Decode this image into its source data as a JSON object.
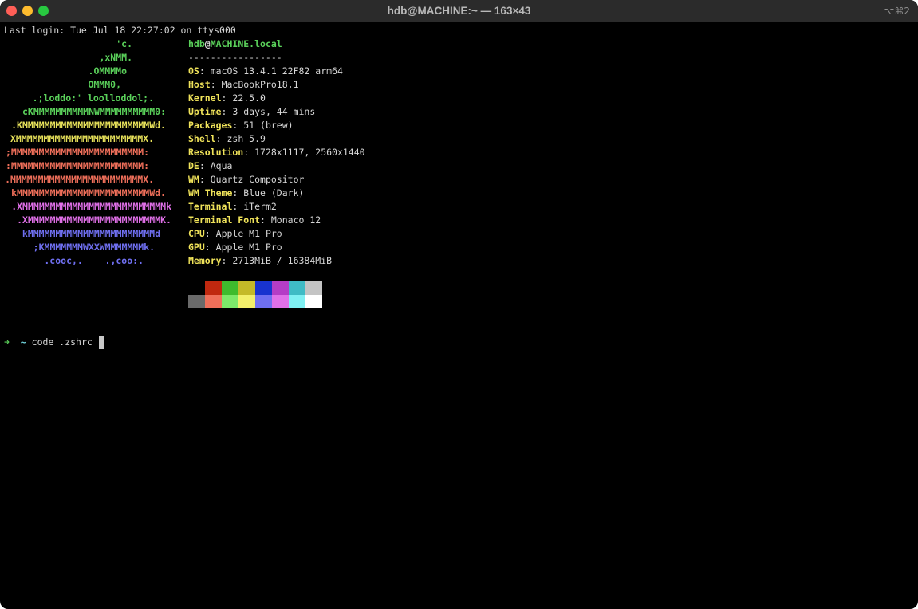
{
  "window": {
    "title": "hdb@MACHINE:~ — 163×43",
    "shortcut": "⌥⌘2",
    "traffic_lights": {
      "close_color": "#ff5f57",
      "minimize_color": "#febc2e",
      "zoom_color": "#28c840"
    }
  },
  "terminal": {
    "last_login": "Last login: Tue Jul 18 22:27:02 on ttys000",
    "logo_lines": [
      {
        "text": "'c.",
        "color": "#5ad05a"
      },
      {
        "text": ",xNMM.",
        "color": "#5ad05a"
      },
      {
        "text": ".OMMMMo",
        "color": "#5ad05a"
      },
      {
        "text": "OMMM0,",
        "color": "#5ad05a"
      },
      {
        "text": ".;loddo:' loolloddol;.",
        "color": "#5ad05a"
      },
      {
        "text": "cKMMMMMMMMMMNWMMMMMMMMMM0:",
        "color": "#5ad05a"
      },
      {
        "text": ".KMMMMMMMMMMMMMMMMMMMMMMMWd.",
        "color": "#e6e05a"
      },
      {
        "text": "XMMMMMMMMMMMMMMMMMMMMMMMX.",
        "color": "#e6e05a"
      },
      {
        "text": ";MMMMMMMMMMMMMMMMMMMMMMMM:",
        "color": "#ef6f5a"
      },
      {
        "text": ":MMMMMMMMMMMMMMMMMMMMMMMM:",
        "color": "#ef6f5a"
      },
      {
        "text": ".MMMMMMMMMMMMMMMMMMMMMMMMX.",
        "color": "#ef6f5a"
      },
      {
        "text": "kMMMMMMMMMMMMMMMMMMMMMMMMWd.",
        "color": "#ef6f5a"
      },
      {
        "text": ".XMMMMMMMMMMMMMMMMMMMMMMMMMMk",
        "color": "#e070e8"
      },
      {
        "text": ".XMMMMMMMMMMMMMMMMMMMMMMMMK.",
        "color": "#e070e8"
      },
      {
        "text": "kMMMMMMMMMMMMMMMMMMMMMMMd",
        "color": "#6f6ff0"
      },
      {
        "text": ";KMMMMMMMWXXWMMMMMMMk.",
        "color": "#6f6ff0"
      },
      {
        "text": ".cooc,.    .,coo:.",
        "color": "#6f6ff0"
      }
    ],
    "user": "hdb",
    "at": "@",
    "host": "MACHINE.local",
    "separator": "-----------------",
    "info": [
      {
        "key": "OS",
        "value": "macOS 13.4.1 22F82 arm64"
      },
      {
        "key": "Host",
        "value": "MacBookPro18,1"
      },
      {
        "key": "Kernel",
        "value": "22.5.0"
      },
      {
        "key": "Uptime",
        "value": "3 days, 44 mins"
      },
      {
        "key": "Packages",
        "value": "51 (brew)"
      },
      {
        "key": "Shell",
        "value": "zsh 5.9"
      },
      {
        "key": "Resolution",
        "value": "1728x1117, 2560x1440"
      },
      {
        "key": "DE",
        "value": "Aqua"
      },
      {
        "key": "WM",
        "value": "Quartz Compositor"
      },
      {
        "key": "WM Theme",
        "value": "Blue (Dark)"
      },
      {
        "key": "Terminal",
        "value": "iTerm2"
      },
      {
        "key": "Terminal Font",
        "value": "Monaco 12"
      },
      {
        "key": "CPU",
        "value": "Apple M1 Pro"
      },
      {
        "key": "GPU",
        "value": "Apple M1 Pro"
      },
      {
        "key": "Memory",
        "value": "2713MiB / 16384MiB"
      }
    ],
    "key_color": "#f0e35a",
    "user_color": "#5ad05a",
    "palette_normal": [
      "#000000",
      "#c0280f",
      "#3fbb2d",
      "#c4b928",
      "#1833cf",
      "#b43dc6",
      "#3fbbc5",
      "#c4c4c4"
    ],
    "palette_bright": [
      "#6a6a6a",
      "#ef6f5a",
      "#7de86a",
      "#f3ef6a",
      "#6f6ff0",
      "#e070e8",
      "#7ff0f3",
      "#ffffff"
    ],
    "prompt": {
      "arrow": "➜",
      "arrow_color": "#5ad05a",
      "dir": "~",
      "dir_color": "#6fd0d8",
      "command": "code .zshrc"
    }
  }
}
